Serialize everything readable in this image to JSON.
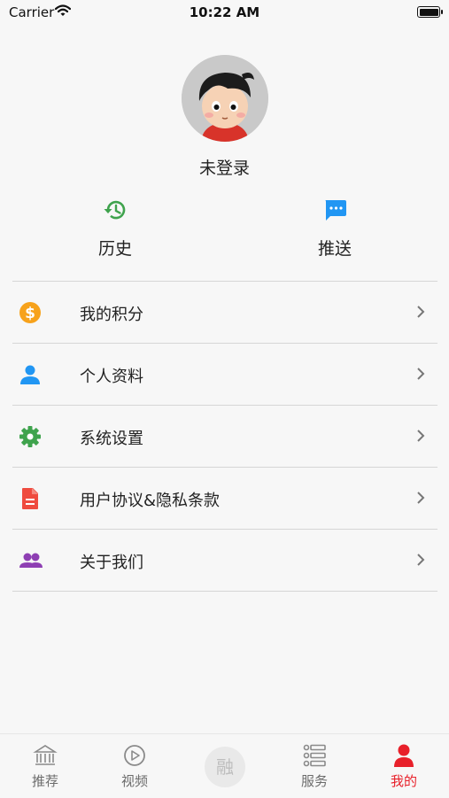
{
  "status_bar": {
    "carrier": "Carrier",
    "time": "10:22 AM"
  },
  "profile": {
    "login_label": "未登录"
  },
  "quick_actions": [
    {
      "label": "历史",
      "icon": "history-icon",
      "color": "#3fa34d"
    },
    {
      "label": "推送",
      "icon": "message-icon",
      "color": "#2196f3"
    }
  ],
  "menu": [
    {
      "label": "我的积分",
      "icon": "coin-icon",
      "color": "#f7a21b"
    },
    {
      "label": "个人资料",
      "icon": "person-icon",
      "color": "#2196f3"
    },
    {
      "label": "系统设置",
      "icon": "gear-icon",
      "color": "#3fa34d"
    },
    {
      "label": "用户协议&隐私条款",
      "icon": "document-icon",
      "color": "#ef4b3f"
    },
    {
      "label": "关于我们",
      "icon": "group-icon",
      "color": "#8e3fb3"
    }
  ],
  "tab_bar": {
    "items": [
      {
        "label": "推荐",
        "icon": "bank-icon",
        "active": false
      },
      {
        "label": "视频",
        "icon": "play-icon",
        "active": false
      },
      {
        "label": "融",
        "icon": "center-logo-icon",
        "active": false
      },
      {
        "label": "服务",
        "icon": "list-icon",
        "active": false
      },
      {
        "label": "我的",
        "icon": "user-icon",
        "active": true
      }
    ],
    "active_color": "#e8202a",
    "inactive_color": "#6b6b6b"
  }
}
